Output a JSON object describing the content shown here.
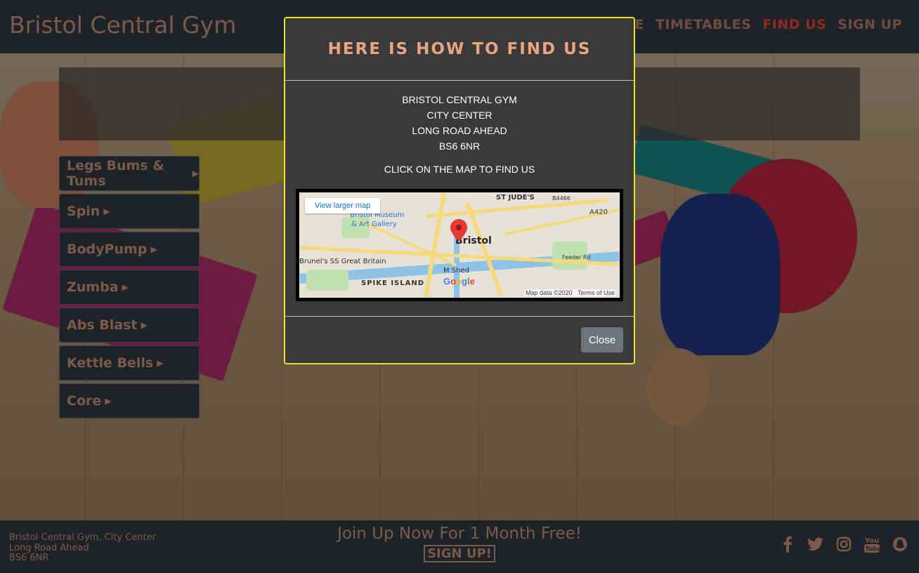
{
  "header": {
    "brand": "Bristol Central Gym",
    "nav": [
      {
        "label": "HOME",
        "active": false
      },
      {
        "label": "TIMETABLES",
        "active": false
      },
      {
        "label": "FIND US",
        "active": true
      },
      {
        "label": "SIGN UP",
        "active": false
      }
    ]
  },
  "side_menu": {
    "items": [
      {
        "label": "Legs Bums & Tums"
      },
      {
        "label": "Spin"
      },
      {
        "label": "BodyPump"
      },
      {
        "label": "Zumba"
      },
      {
        "label": "Abs Blast"
      },
      {
        "label": "Kettle Bells"
      },
      {
        "label": "Core"
      }
    ],
    "caret_icon": "caret-right-icon"
  },
  "modal": {
    "title": "HERE IS HOW TO FIND US",
    "address_lines": [
      "BRISTOL CENTRAL GYM",
      "CITY CENTER",
      "LONG ROAD AHEAD",
      "BS6 6NR"
    ],
    "cta": "CLICK ON THE MAP TO FIND US",
    "map": {
      "view_larger": "View larger map",
      "center_label": "Bristol",
      "labels": [
        "ST JUDE'S",
        "Bristol Museum",
        "& Art Gallery",
        "Brunel's SS Great Britain",
        "M Shed",
        "SPIKE ISLAND",
        "A420",
        "B4466",
        "Feeder Rd"
      ],
      "logo": "Google",
      "attribution": "Map data ©2020",
      "terms": "Terms of Use"
    },
    "close_label": "Close"
  },
  "footer": {
    "address_lines": [
      "Bristol Central Gym, City Center",
      "Long Road Ahead",
      "BS6 6NR"
    ],
    "promo": "Join Up Now For 1 Month Free!",
    "signup": "SIGN UP!",
    "social": [
      {
        "icon": "facebook-icon",
        "glyph": "f"
      },
      {
        "icon": "twitter-icon",
        "glyph": "t"
      },
      {
        "icon": "instagram-icon",
        "glyph": "◎"
      },
      {
        "icon": "youtube-icon",
        "glyph": "▶"
      },
      {
        "icon": "snapchat-icon",
        "glyph": "☺"
      }
    ]
  },
  "colors": {
    "brand": "#7a5a48",
    "nav_active": "#8d2a22",
    "modal_border": "#e8e331",
    "modal_title": "#e9a57f",
    "close_button": "#6c757d"
  }
}
